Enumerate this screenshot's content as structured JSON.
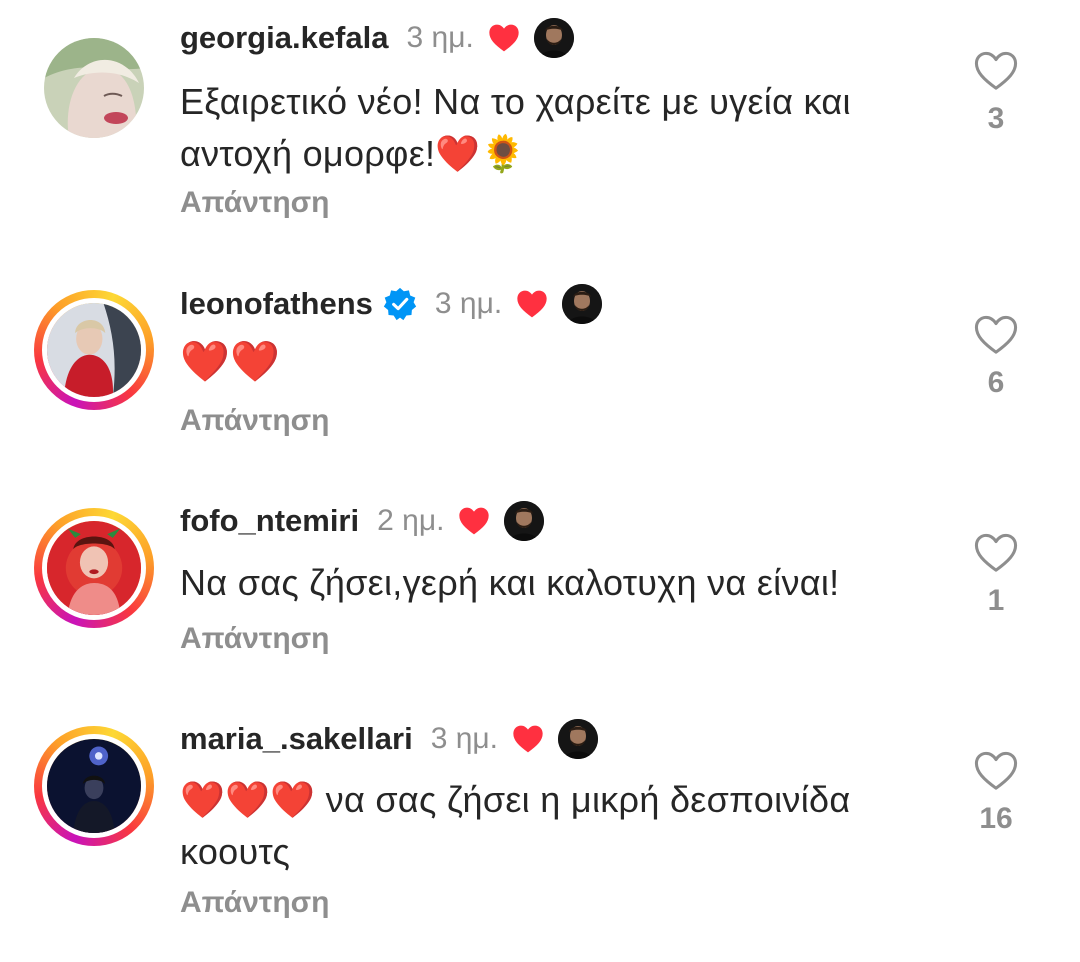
{
  "comments": [
    {
      "username": "georgia.kefala",
      "verified": false,
      "time": "3 ημ.",
      "text": "Εξαιρετικό νέο! Να το χαρείτε με υγεία και αντοχή ομορφε!❤️🌻",
      "reply_label": "Απάντηση",
      "like_count": "3"
    },
    {
      "username": "leonofathens",
      "verified": true,
      "time": "3 ημ.",
      "text": "❤️❤️",
      "reply_label": "Απάντηση",
      "like_count": "6"
    },
    {
      "username": "fofo_ntemiri",
      "verified": false,
      "time": "2 ημ.",
      "text": "Να σας ζήσει,γερή και καλοτυχη να είναι!",
      "reply_label": "Απάντηση",
      "like_count": "1"
    },
    {
      "username": "maria_.sakellari",
      "verified": false,
      "time": "3 ημ.",
      "text": "❤️❤️❤️ να σας ζήσει η μικρή δεσποινίδα κοουτς",
      "reply_label": "Απάντηση",
      "like_count": "16"
    }
  ],
  "icons": {
    "liked_by_author": "heart-filled-icon",
    "like": "heart-outline-icon",
    "verified": "verified-badge-icon"
  },
  "colors": {
    "heart_red": "#ff3040",
    "verified_blue": "#0095f6",
    "muted_text": "#8e8e8e"
  }
}
